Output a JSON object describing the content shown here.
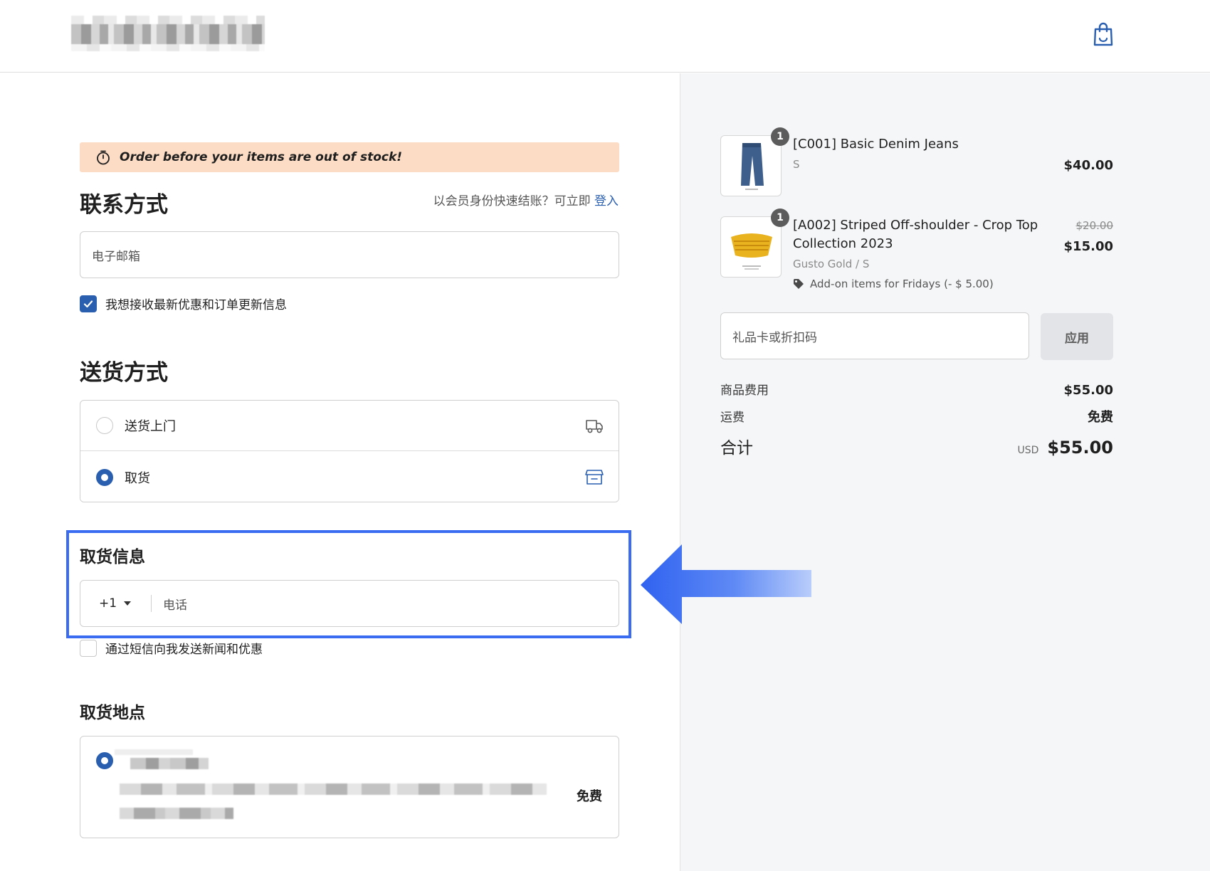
{
  "header": {
    "logo_icon": "blurred-store-logo",
    "cart_icon": "shopping-bag-icon"
  },
  "banner": {
    "icon": "timer-icon",
    "text": "Order before your items are out of stock!"
  },
  "contact": {
    "heading": "联系方式",
    "login_hint": "以会员身份快速结账？可立即",
    "login_link": "登入",
    "email_placeholder": "电子邮箱",
    "newsletter_label": "我想接收最新优惠和订单更新信息",
    "newsletter_checked": true
  },
  "delivery": {
    "heading": "送货方式",
    "options": [
      {
        "label": "送货上门",
        "icon": "truck-icon",
        "selected": false
      },
      {
        "label": "取货",
        "icon": "store-icon",
        "selected": true
      }
    ]
  },
  "pickup_info": {
    "heading": "取货信息",
    "country_code": "+1",
    "phone_placeholder": "电话",
    "sms_label": "通过短信向我发送新闻和优惠",
    "sms_checked": false
  },
  "pickup_location": {
    "heading": "取货地点",
    "price_label": "免费",
    "selected": true
  },
  "cart": {
    "items": [
      {
        "title": "[C001] Basic Denim Jeans",
        "variant": "S",
        "quantity": "1",
        "price": "$40.00",
        "image": "jeans-image"
      },
      {
        "title": "[A002] Striped Off-shoulder - Crop Top Collection 2023",
        "variant": "Gusto Gold / S",
        "quantity": "1",
        "old_price": "$20.00",
        "price": "$15.00",
        "discount": "Add-on items for Fridays (- $ 5.00)",
        "image": "crop-top-image"
      }
    ],
    "discount_code_placeholder": "礼品卡或折扣码",
    "apply_label": "应用"
  },
  "summary": {
    "subtotal_label": "商品费用",
    "subtotal_value": "$55.00",
    "shipping_label": "运费",
    "shipping_value": "免费",
    "total_label": "合计",
    "currency": "USD",
    "total_value": "$55.00"
  },
  "colors": {
    "accent": "#2a5fb0",
    "banner_bg": "#fcdcc4",
    "highlight": "#3a6cf2",
    "summary_bg": "#f5f6f8"
  }
}
